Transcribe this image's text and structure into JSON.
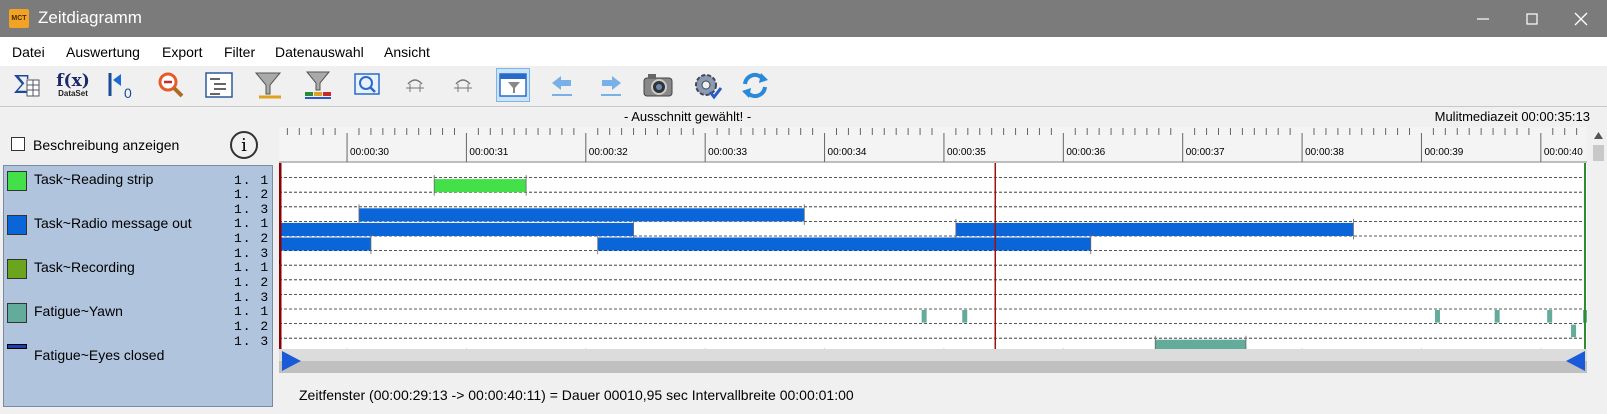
{
  "window": {
    "title": "Zeitdiagramm",
    "app_icon_text": "MCT"
  },
  "menu": [
    "Datei",
    "Auswertung",
    "Export",
    "Filter",
    "Datenauswahl",
    "Ansicht"
  ],
  "toolbar_icons": [
    "sum-table-icon",
    "function-dataset-icon",
    "go-to-start-icon",
    "zoom-out-icon",
    "list-tree-icon",
    "filter-funnel-icon",
    "filter-color-icon",
    "zoom-window-icon",
    "marker-left-icon",
    "marker-right-icon",
    "filter-view-icon",
    "arrow-left-icon",
    "arrow-right-icon",
    "camera-icon",
    "settings-gear-icon",
    "refresh-icon"
  ],
  "toolbar_labels": {
    "fx": "f(x)",
    "dataset": "DataSet",
    "zero": "0"
  },
  "status": {
    "center": "- Ausschnitt gewählt! -",
    "right": "Mulitmediazeit 00:00:35:13"
  },
  "description_checkbox": {
    "label": "Beschreibung anzeigen",
    "checked": false
  },
  "info_icon": "i",
  "legend": [
    {
      "label": "Task~Reading strip",
      "color": "#44e04a",
      "style": "box"
    },
    {
      "label": "Task~Radio message out",
      "color": "#0a66d8",
      "style": "box"
    },
    {
      "label": "Task~Recording",
      "color": "#6aa51d",
      "style": "box"
    },
    {
      "label": "Fatigue~Yawn",
      "color": "#63ab9a",
      "style": "box"
    },
    {
      "label": "Fatigue~Eyes closed",
      "color": "#1a3fb0",
      "style": "line"
    }
  ],
  "row_labels": [
    "1. 1",
    "1. 2",
    "1. 3",
    "1. 1",
    "1. 2",
    "1. 3",
    "1. 1",
    "1. 2",
    "1. 3",
    "1. 1",
    "1. 2",
    "1. 3"
  ],
  "time_axis": [
    "00:00:30",
    "00:00:31",
    "00:00:32",
    "00:00:33",
    "00:00:34",
    "00:00:35",
    "00:00:36",
    "00:00:37",
    "00:00:38",
    "00:00:39",
    "00:00:40"
  ],
  "timeline": {
    "window_start_s": 29.43,
    "window_end_s": 40.37,
    "cursor_s": 35.43,
    "bars": [
      {
        "row": 1,
        "start": 30.73,
        "end": 31.5,
        "color": "#44e04a"
      },
      {
        "row": 3,
        "start": 30.1,
        "end": 33.83,
        "color": "#0a66d8"
      },
      {
        "row": 4,
        "start": 29.43,
        "end": 32.4,
        "color": "#0a66d8"
      },
      {
        "row": 4,
        "start": 35.1,
        "end": 38.43,
        "color": "#0a66d8"
      },
      {
        "row": 5,
        "start": 29.43,
        "end": 30.2,
        "color": "#0a66d8"
      },
      {
        "row": 5,
        "start": 32.1,
        "end": 36.23,
        "color": "#0a66d8"
      },
      {
        "row": 12,
        "start": 36.77,
        "end": 37.53,
        "color": "#63ab9a"
      }
    ],
    "markers": [
      {
        "row": 10,
        "t": 34.83,
        "color": "#63ab9a"
      },
      {
        "row": 10,
        "t": 35.17,
        "color": "#63ab9a"
      },
      {
        "row": 10,
        "t": 39.13,
        "color": "#63ab9a"
      },
      {
        "row": 10,
        "t": 39.63,
        "color": "#63ab9a"
      },
      {
        "row": 10,
        "t": 40.07,
        "color": "#63ab9a"
      },
      {
        "row": 10,
        "t": 40.37,
        "color": "#63ab9a"
      },
      {
        "row": 10,
        "t": 40.5,
        "color": "#63ab9a"
      },
      {
        "row": 11,
        "t": 40.27,
        "color": "#63ab9a"
      },
      {
        "row": 11,
        "t": 40.5,
        "color": "#63ab9a"
      },
      {
        "row": 11,
        "t": 40.59,
        "color": "#63ab9a"
      }
    ],
    "lines": [
      {
        "row": 13,
        "start": 36.47,
        "end": 36.99,
        "color": "#1a3fb0"
      }
    ]
  },
  "bottom_status": "Zeitfenster  (00:00:29:13 -> 00:00:40:11) = Dauer 00010,95 sec   Intervallbreite 00:00:01:00"
}
